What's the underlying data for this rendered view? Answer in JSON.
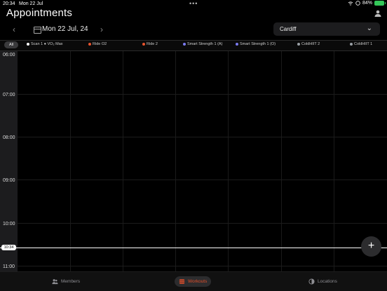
{
  "status": {
    "time": "20:34",
    "date": "Mon 22 Jul",
    "battery": "84%"
  },
  "header": {
    "title": "Appointments"
  },
  "date_nav": {
    "prev": "‹",
    "next": "›",
    "label": "Mon 22 Jul, 24"
  },
  "location": {
    "value": "Cardiff",
    "chevron": "⌄"
  },
  "tabs": [
    {
      "label": "All",
      "color": ""
    },
    {
      "label": "Scan 1 ● VO₂ Max",
      "color": "#ffffff"
    },
    {
      "label": "Ride O2",
      "color": "#e8532d"
    },
    {
      "label": "Ride 2",
      "color": "#e8532d"
    },
    {
      "label": "Smart Strength 1 (A)",
      "color": "#7b7bf0"
    },
    {
      "label": "Smart Strength 1 (O)",
      "color": "#7b7bf0"
    },
    {
      "label": "ColdHIIT 2",
      "color": "#9aa0a6"
    },
    {
      "label": "ColdHIIT 1",
      "color": "#9aa0a6"
    }
  ],
  "times": [
    "06:00",
    "07:00",
    "08:00",
    "09:00",
    "10:00",
    "11:00"
  ],
  "now_badge": "10:34",
  "fab_label": "+",
  "bottom_nav": [
    {
      "label": "Members"
    },
    {
      "label": "Workouts"
    },
    {
      "label": "Locations"
    }
  ]
}
